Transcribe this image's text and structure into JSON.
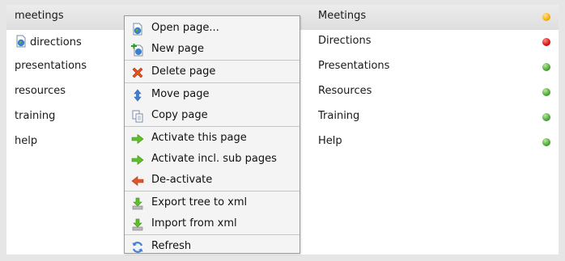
{
  "rows": [
    {
      "name": "meetings",
      "title": "Meetings",
      "status": "yellow",
      "selected": true
    },
    {
      "name": "directions",
      "title": "Directions",
      "status": "red",
      "icon": "globe-page-icon"
    },
    {
      "name": "presentations",
      "title": "Presentations",
      "status": "green"
    },
    {
      "name": "resources",
      "title": "Resources",
      "status": "green"
    },
    {
      "name": "training",
      "title": "Training",
      "status": "green"
    },
    {
      "name": "help",
      "title": "Help",
      "status": "green"
    }
  ],
  "menu": {
    "open_page": "Open page...",
    "new_page": "New page",
    "delete_page": "Delete page",
    "move_page": "Move page",
    "copy_page": "Copy page",
    "activate_this_page": "Activate this page",
    "activate_incl_sub": "Activate incl. sub pages",
    "deactivate": "De-activate",
    "export_tree": "Export tree to xml",
    "import_xml": "Import from xml",
    "refresh": "Refresh"
  },
  "colors": {
    "status_yellow": "#f3a400",
    "status_red": "#d40000",
    "status_green": "#3e9a2e",
    "activate_arrow": "#5fbf2a",
    "deactivate_arrow": "#e2552b",
    "delete_x": "#e8501c"
  },
  "icons": {
    "open_page": "globe-page-icon",
    "new_page": "new-page-icon",
    "delete_page": "delete-x-icon",
    "move_page": "move-arrows-icon",
    "copy_page": "copy-page-icon",
    "activate": "green-arrow-right-icon",
    "deactivate": "red-arrow-left-icon",
    "export": "export-download-icon",
    "import": "import-download-icon",
    "refresh": "refresh-icon"
  }
}
